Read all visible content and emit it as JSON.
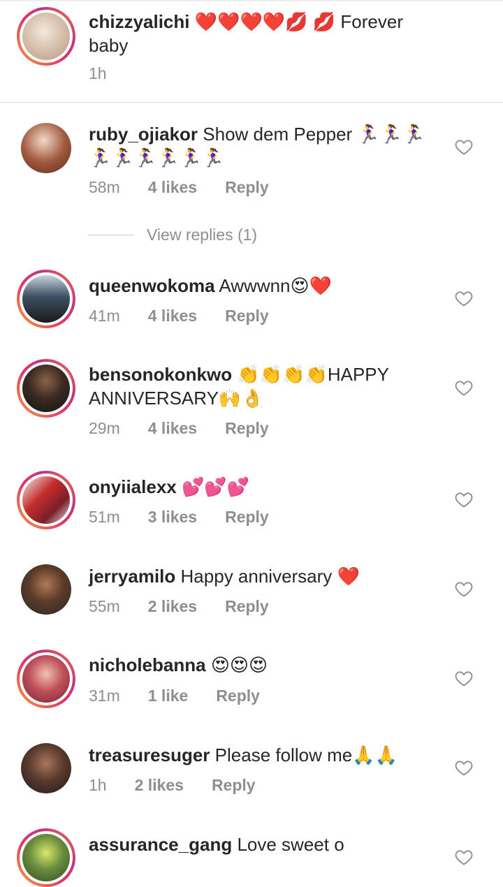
{
  "comments": [
    {
      "user": "chizzyalichi",
      "text": "❤️❤️❤️❤️💋 💋 Forever baby",
      "time": "1h",
      "likes": "",
      "reply": ""
    },
    {
      "user": "ruby_ojiakor",
      "text": "Show dem Pepper 🏃‍♀️🏃‍♀️🏃‍♀️🏃‍♀️🏃‍♀️🏃‍♀️🏃‍♀️🏃‍♀️🏃‍♀️",
      "time": "58m",
      "likes": "4 likes",
      "reply": "Reply"
    },
    {
      "user": "queenwokoma",
      "text": "Awwwnn😍❤️",
      "time": "41m",
      "likes": "4 likes",
      "reply": "Reply"
    },
    {
      "user": "bensonokonkwo",
      "text": "👏👏👏👏HAPPY ANNIVERSARY🙌👌",
      "time": "29m",
      "likes": "4 likes",
      "reply": "Reply"
    },
    {
      "user": "onyiialexx",
      "text": "💕💕💕",
      "time": "51m",
      "likes": "3 likes",
      "reply": "Reply"
    },
    {
      "user": "jerryamilo",
      "text": "Happy anniversary ❤️",
      "time": "55m",
      "likes": "2 likes",
      "reply": "Reply"
    },
    {
      "user": "nicholebanna",
      "text": "😍😍😍",
      "time": "31m",
      "likes": "1 like",
      "reply": "Reply"
    },
    {
      "user": "treasuresuger",
      "text": "Please follow me🙏🙏",
      "time": "1h",
      "likes": "2 likes",
      "reply": "Reply"
    },
    {
      "user": "assurance_gang",
      "text": "Love sweet o",
      "time": "",
      "likes": "",
      "reply": ""
    }
  ],
  "view_replies": "View replies (1)",
  "colors": {
    "text": "#262626",
    "meta": "#8e8e8e",
    "divider": "#dbdbdb"
  }
}
